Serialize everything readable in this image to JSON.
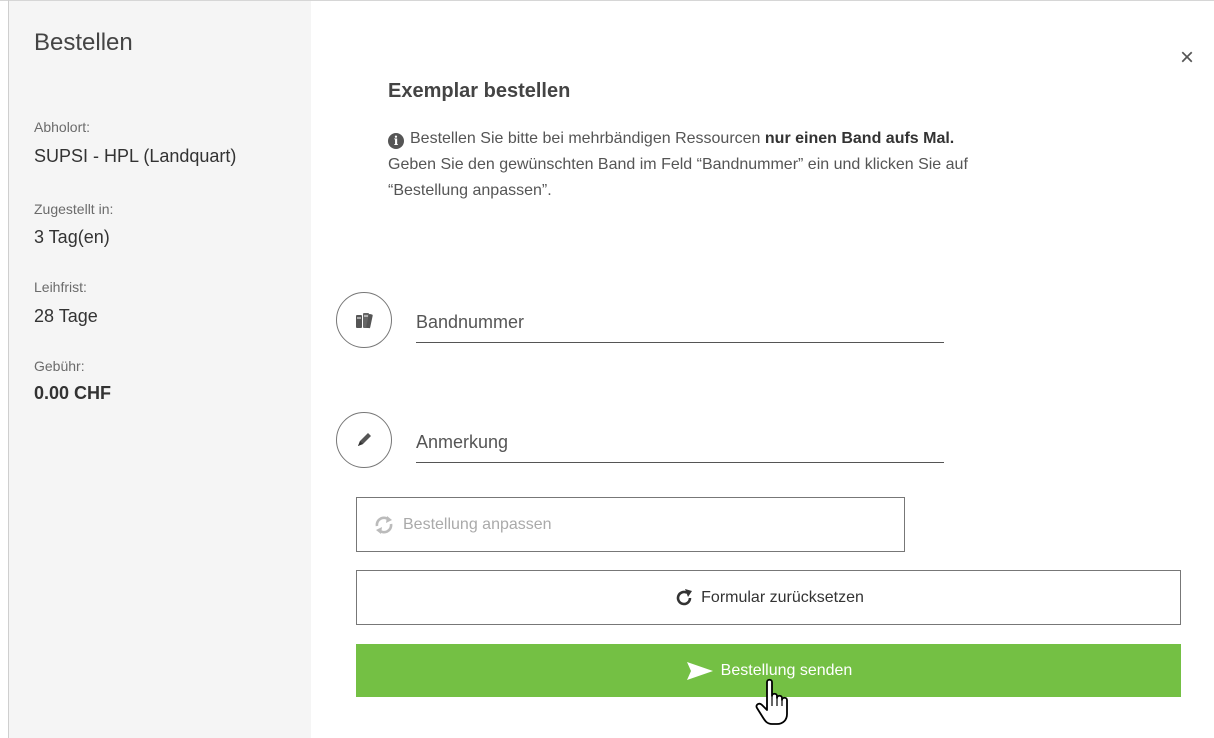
{
  "sidebar": {
    "title": "Bestellen",
    "pickup_label": "Abholort:",
    "pickup_value": "SUPSI - HPL (Landquart)",
    "delivery_label": "Zugestellt in:",
    "delivery_value": "3 Tag(en)",
    "loan_label": "Leihfrist:",
    "loan_value": "28 Tage",
    "fee_label": "Gebühr:",
    "fee_value": "0.00 CHF"
  },
  "dialog": {
    "close_glyph": "×",
    "title": "Exemplar bestellen",
    "notice": {
      "part1": "Bestellen Sie bitte bei mehrbändigen Ressourcen ",
      "bold": "nur einen Band aufs Mal.",
      "part2": " Geben Sie den gewünschten Band im Feld “Bandnummer” ein und klicken Sie auf “Bestellung anpassen”."
    },
    "volume_field": {
      "placeholder": "Bandnummer",
      "icon": "books-icon"
    },
    "note_field": {
      "placeholder": "Anmerkung",
      "icon": "pencil-icon"
    },
    "buttons": {
      "adjust": "Bestellung anpassen",
      "reset": "Formular zurücksetzen",
      "send": "Bestellung senden"
    }
  },
  "colors": {
    "send_button": "#74c044",
    "sidebar_bg": "#f5f5f5"
  }
}
